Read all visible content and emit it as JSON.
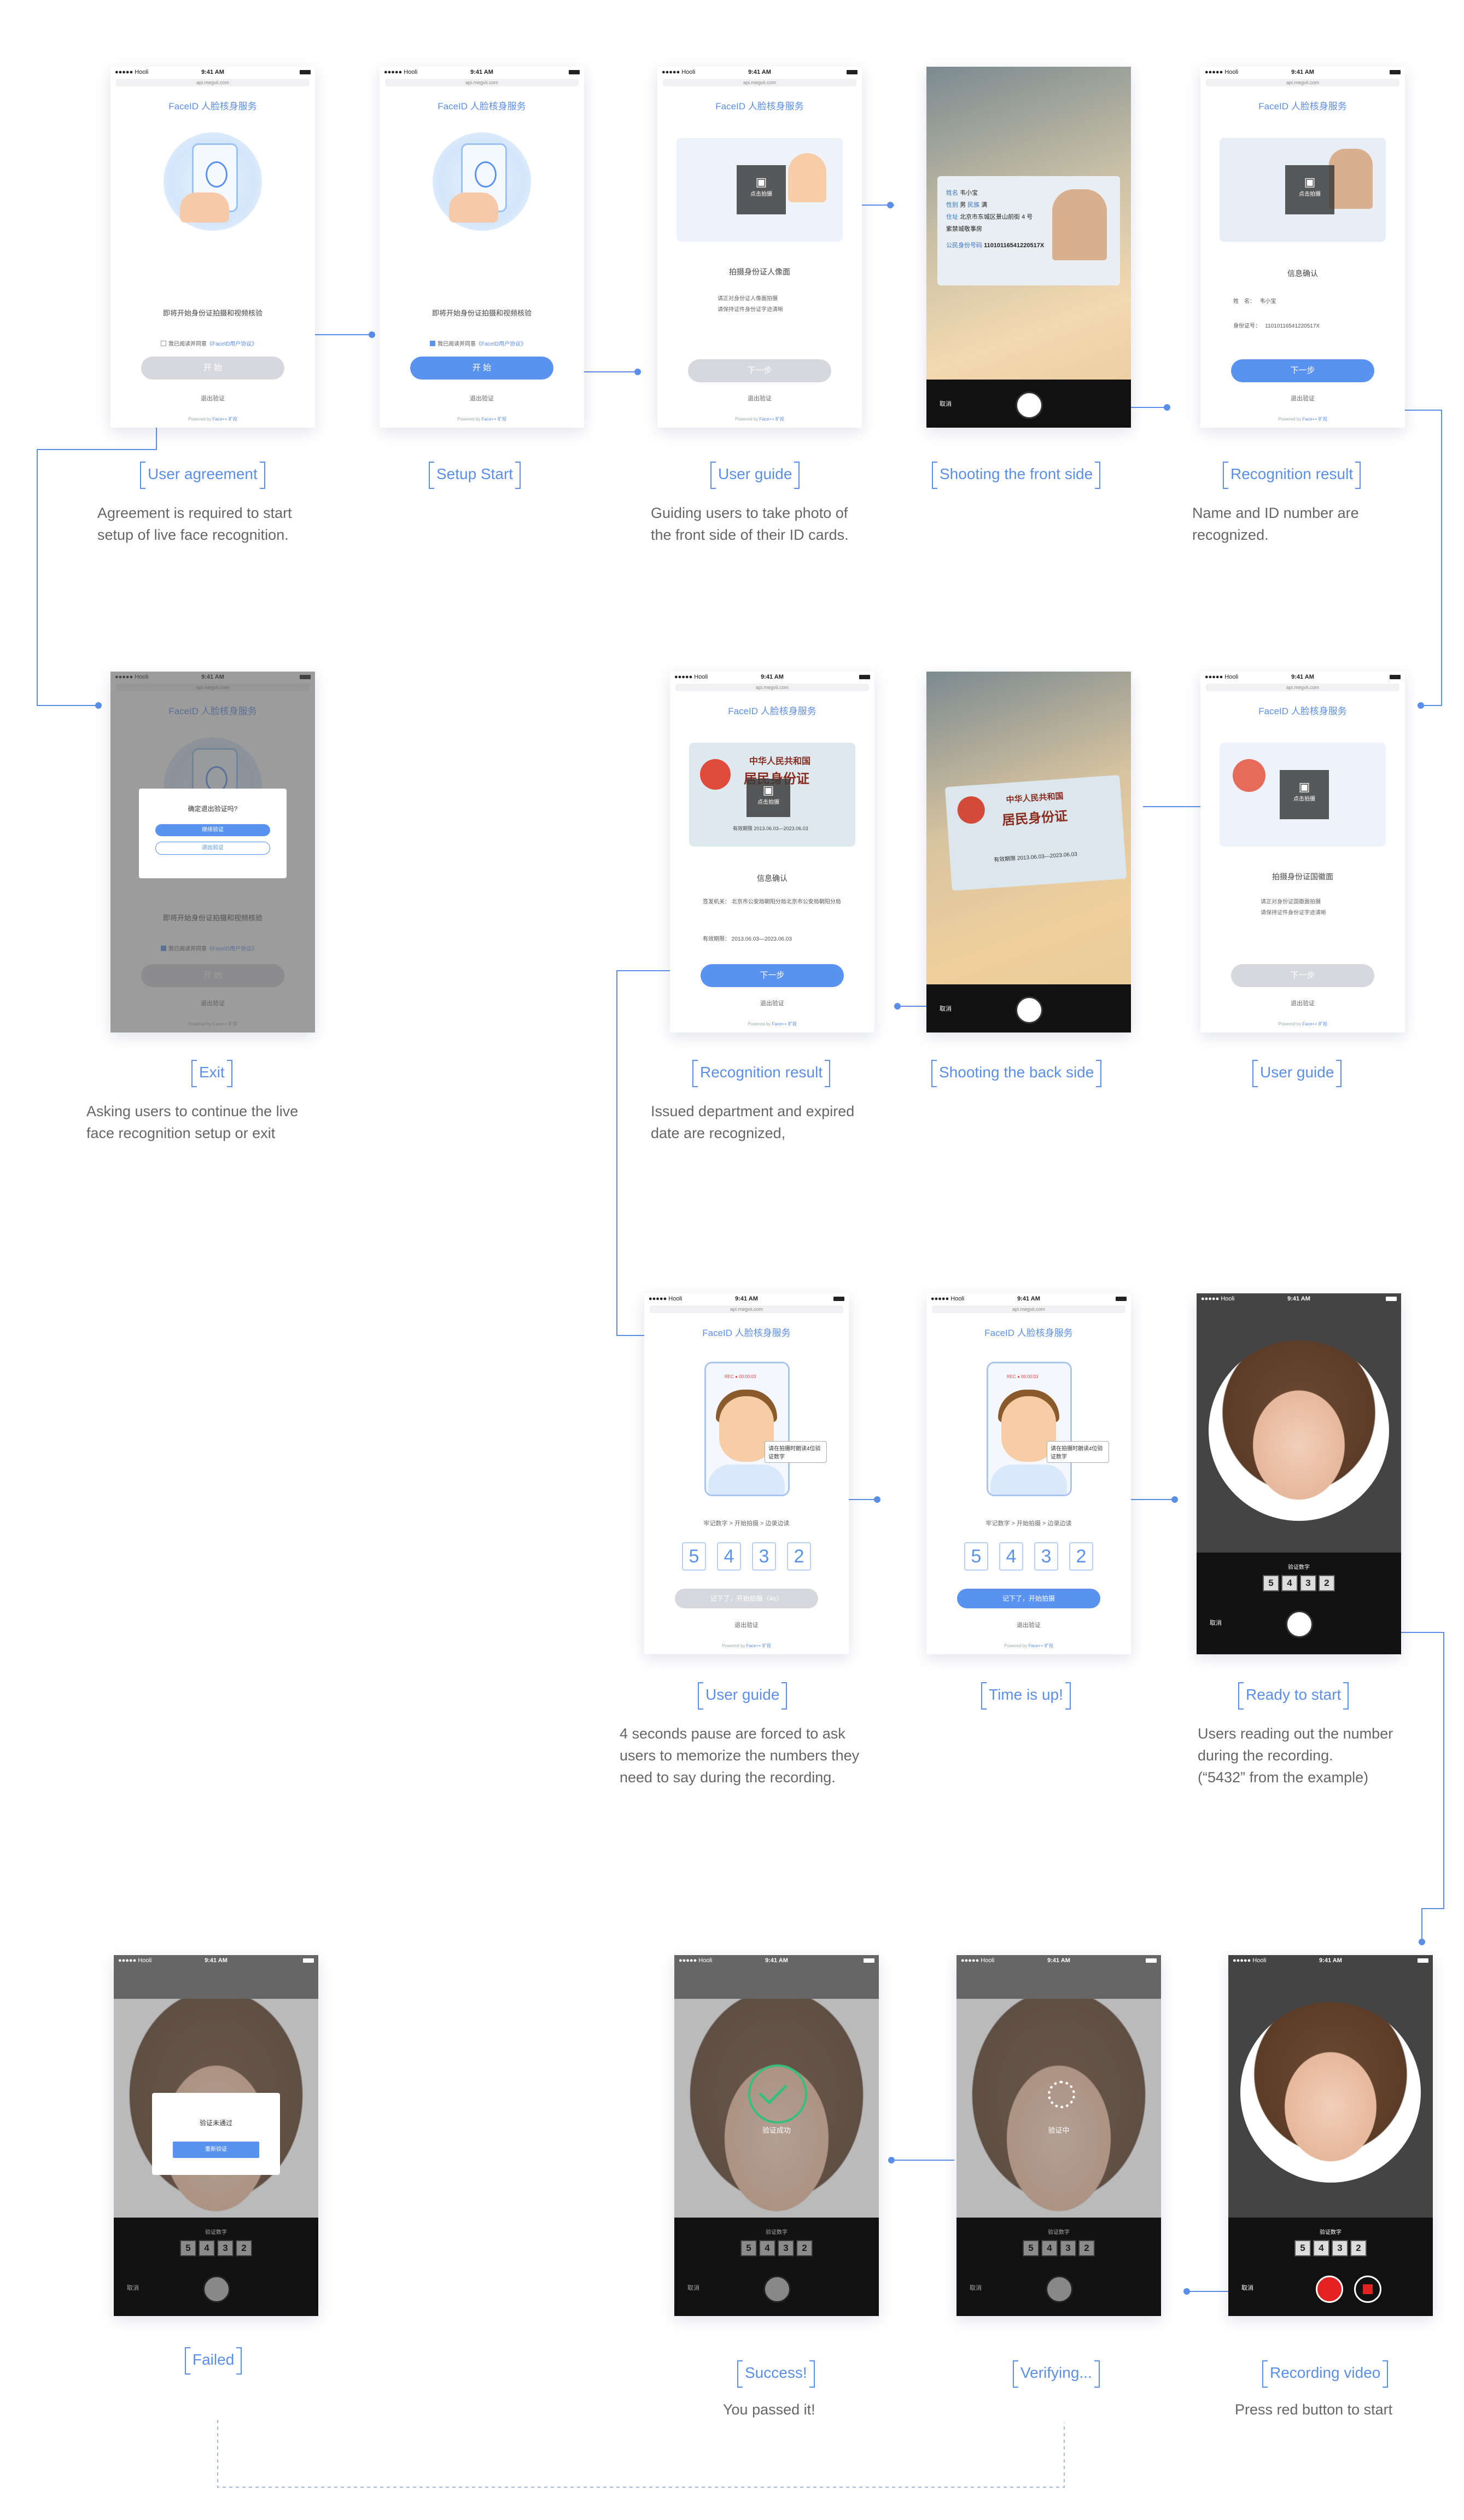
{
  "common": {
    "carrier": "●●●●● Hooli",
    "time": "9:41 AM",
    "url": "api.megvii.com",
    "page_title": "FaceID 人脸核身服务",
    "exit_verify": "退出验证",
    "powered": "Powered by",
    "powered_brand": "Face++ 旷视",
    "cancel": "取消",
    "next_btn": "下一步",
    "start_btn": "开 始",
    "tap_to_shoot": "点击拍摄"
  },
  "screens": {
    "agreement": {
      "desc": "即将开始身份证拍摄和视频核验",
      "check": "我已阅读并同意",
      "link": "《FaceID用户协议》"
    },
    "front_guide": {
      "title": "拍摄身份证人像面",
      "tips": [
        "请正对身份证人像面拍摄",
        "请保持证件身份证字迹清晰"
      ]
    },
    "front_shoot": {
      "name_label": "姓名",
      "name": "韦小宝",
      "sex_label": "性别",
      "sex": "男",
      "nation_label": "民族",
      "nation": "满",
      "addr_label": "住址",
      "addr": "北京市东城区景山前街 4 号 紫禁城敬事房",
      "id_label": "公民身份号码",
      "id": "11010116541220517X"
    },
    "recog_front": {
      "title": "信息确认",
      "name_label": "姓　名：",
      "name": "韦小宝",
      "id_label": "身份证号：",
      "id": "11010116541220517X"
    },
    "back_guide": {
      "title": "拍摄身份证国徽面",
      "tips": [
        "请正对身份证国徽面拍摄",
        "请保持证件身份证字迹清晰"
      ]
    },
    "back_card": {
      "line1": "中华人民共和国",
      "line2": "居民身份证",
      "issue_label": "签发机关",
      "issue": "北京市公安局朝阳分局",
      "valid_label": "有效期限",
      "valid": "2013.06.03—2023.06.03"
    },
    "recog_back": {
      "title": "信息确认",
      "issue_label": "签发机关：",
      "issue": "北京市公安局朝阳分局北京市公安局朝阳分局",
      "valid_label": "有效期限：",
      "valid": "2013.06.03—2023.06.03"
    },
    "record_guide": {
      "steps": "牢记数字 > 开始拍摄 > 边录边读",
      "bubble": "请在拍摄时朗读4位验证数字",
      "digits": [
        "5",
        "4",
        "3",
        "2"
      ],
      "btn_wait": "记下了，开始拍摄（4s）",
      "btn_ready": "记下了，开始拍摄",
      "rec": "REC ● 00:00:03"
    },
    "exit_dialog": {
      "title": "确定退出验证吗?",
      "continue": "继续验证",
      "exit": "退出验证"
    },
    "video": {
      "label": "验证数字",
      "digits": [
        "5",
        "4",
        "3",
        "2"
      ]
    },
    "failed": {
      "msg": "验证未通过",
      "retry": "重新验证"
    },
    "success": {
      "msg": "验证成功"
    },
    "verifying": {
      "msg": "验证中"
    }
  },
  "captions": {
    "user_agreement": {
      "title": "User agreement",
      "desc": [
        "Agreement is required to start",
        "setup of live face recognition."
      ]
    },
    "setup_start": {
      "title": "Setup Start"
    },
    "user_guide_1": {
      "title": "User guide",
      "desc": [
        "Guiding users to take photo of",
        "the front side of their ID cards."
      ]
    },
    "shoot_front": {
      "title": "Shooting the front side"
    },
    "recog_result_1": {
      "title": "Recognition result",
      "desc": [
        "Name and ID number are",
        "recognized."
      ]
    },
    "exit": {
      "title": "Exit",
      "desc": [
        "Asking users to continue the live",
        "face recognition setup or exit"
      ]
    },
    "recog_result_2": {
      "title": "Recognition result",
      "desc": [
        "Issued department and expired",
        "date are recognized,"
      ]
    },
    "shoot_back": {
      "title": "Shooting the back side"
    },
    "user_guide_2": {
      "title": "User guide"
    },
    "user_guide_3": {
      "title": "User guide",
      "desc": [
        "4 seconds pause are forced to ask",
        "users to memorize the numbers they",
        "need to say during the recording."
      ]
    },
    "time_up": {
      "title": "Time is up!"
    },
    "ready": {
      "title": "Ready to start",
      "desc": [
        "Users reading out the number",
        "during the recording.",
        "(“5432” from the example)"
      ]
    },
    "failed": {
      "title": "Failed"
    },
    "success": {
      "title": "Success!",
      "desc": [
        "You passed it!"
      ]
    },
    "verifying": {
      "title": "Verifying..."
    },
    "recording": {
      "title": "Recording video",
      "desc": [
        "Press red button to start"
      ]
    }
  },
  "colors": {
    "accent": "#5b8eea",
    "success": "#35c07a",
    "record": "#e52222"
  }
}
